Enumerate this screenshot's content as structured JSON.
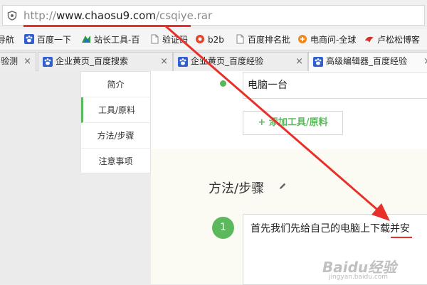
{
  "address_bar": {
    "scheme": "http://",
    "domain": "www.chaosu9.com",
    "path": "/csqiye.rar"
  },
  "bookmarks": [
    {
      "label": "导航",
      "icon": "none"
    },
    {
      "label": "百度一下",
      "icon": "baidu-paw-icon"
    },
    {
      "label": "站长工具-百",
      "icon": "chinaz-icon"
    },
    {
      "label": "验证码",
      "icon": "page-icon"
    },
    {
      "label": "b2b",
      "icon": "b2b-icon"
    },
    {
      "label": "百度排名批",
      "icon": "page-icon"
    },
    {
      "label": "电商问-全球",
      "icon": "orange-circle-icon"
    },
    {
      "label": "卢松松博客",
      "icon": "bird-icon"
    }
  ],
  "tabs": [
    {
      "label": "验测",
      "close": "×"
    },
    {
      "label": "企业黄页_百度搜索",
      "close": "×"
    },
    {
      "label": "企业黄页_百度经验",
      "close": "×"
    },
    {
      "label": "高级编辑器_百度经验",
      "close": "×"
    }
  ],
  "sidenav": {
    "items": [
      {
        "label": "简介"
      },
      {
        "label": "工具/原料"
      },
      {
        "label": "方法/步骤"
      },
      {
        "label": "注意事项"
      }
    ]
  },
  "tools": {
    "value": "电脑一台",
    "add_button": "+ 添加工具/原料"
  },
  "steps": {
    "section_title": "方法/步骤",
    "step_number": "1",
    "step_text": "首先我们先给自己的电脑上下载并安"
  },
  "watermark": {
    "main": "Baidu经验",
    "sub": "jingyan.baidu.com"
  },
  "colors": {
    "accent_green": "#5bb85d",
    "annotation_red": "#e8302b"
  }
}
